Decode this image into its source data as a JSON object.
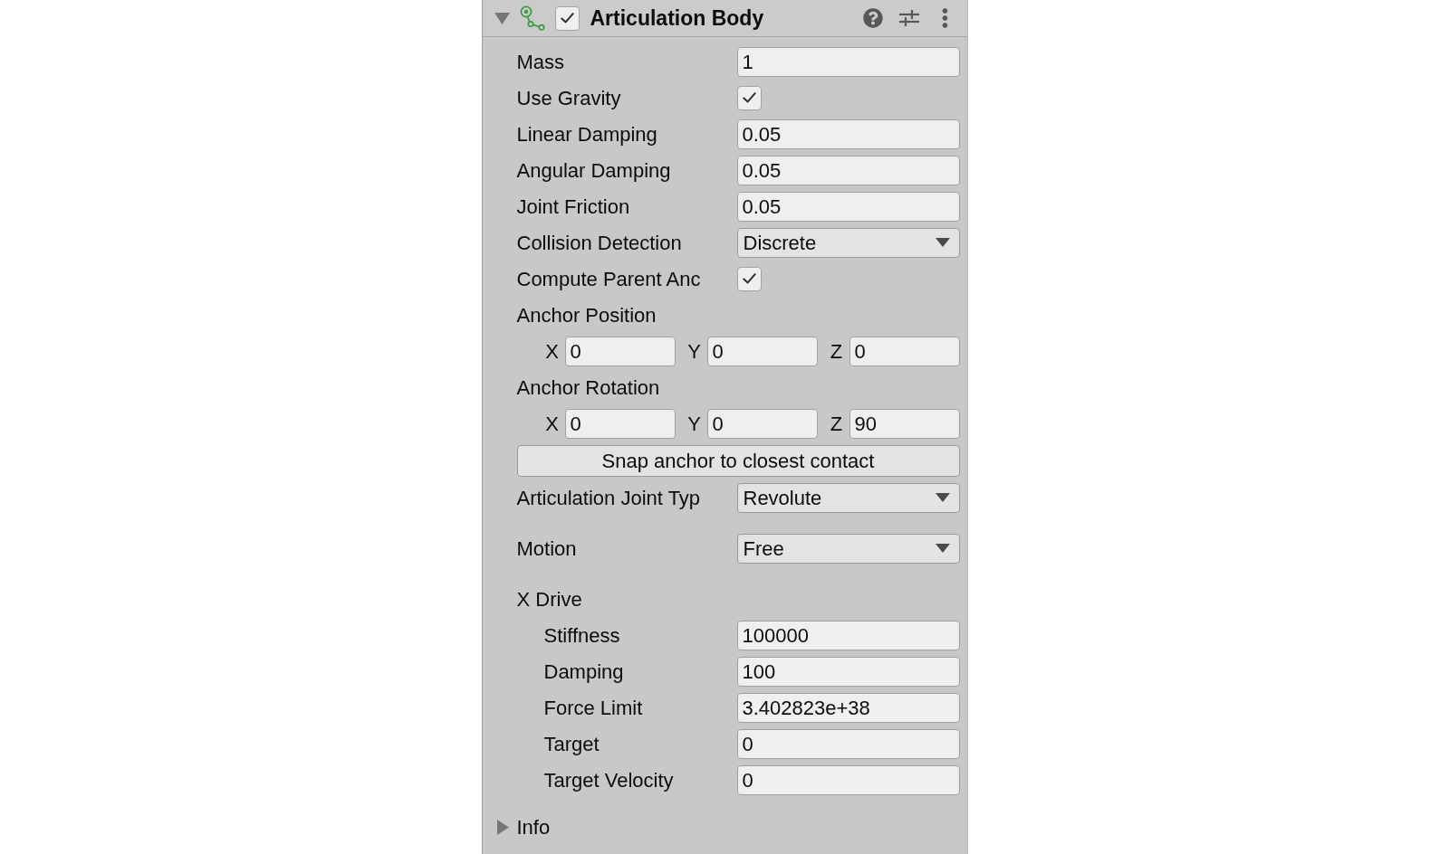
{
  "component": {
    "title": "Articulation Body",
    "expanded": true,
    "enabled": true
  },
  "groups": [
    {
      "properties": [
        {
          "kind": "number",
          "label": "Mass",
          "value": "1"
        },
        {
          "kind": "toggle",
          "label": "Use Gravity",
          "checked": true
        },
        {
          "kind": "number",
          "label": "Linear Damping",
          "value": "0.05"
        },
        {
          "kind": "number",
          "label": "Angular Damping",
          "value": "0.05"
        },
        {
          "kind": "number",
          "label": "Joint Friction",
          "value": "0.05"
        },
        {
          "kind": "dropdown",
          "label": "Collision Detection",
          "value": "Discrete"
        },
        {
          "kind": "toggle",
          "label": "Compute Parent Anc",
          "checked": true
        },
        {
          "kind": "vector",
          "label": "Anchor Position",
          "components": [
            {
              "axis": "X",
              "value": "0"
            },
            {
              "axis": "Y",
              "value": "0"
            },
            {
              "axis": "Z",
              "value": "0"
            }
          ]
        },
        {
          "kind": "vector",
          "label": "Anchor Rotation",
          "components": [
            {
              "axis": "X",
              "value": "0"
            },
            {
              "axis": "Y",
              "value": "0"
            },
            {
              "axis": "Z",
              "value": "90"
            }
          ]
        },
        {
          "kind": "button",
          "label": "Snap anchor to closest contact"
        },
        {
          "kind": "dropdown",
          "label": "Articulation Joint Typ",
          "value": "Revolute"
        }
      ]
    },
    {
      "properties": [
        {
          "kind": "dropdown",
          "label": "Motion",
          "value": "Free"
        }
      ]
    },
    {
      "properties": [
        {
          "kind": "section",
          "label": "X Drive",
          "children": [
            {
              "kind": "number",
              "label": "Stiffness",
              "value": "100000"
            },
            {
              "kind": "number",
              "label": "Damping",
              "value": "100"
            },
            {
              "kind": "number",
              "label": "Force Limit",
              "value": "3.402823e+38"
            },
            {
              "kind": "number",
              "label": "Target",
              "value": "0"
            },
            {
              "kind": "number",
              "label": "Target Velocity",
              "value": "0"
            }
          ]
        }
      ]
    }
  ],
  "info": {
    "label": "Info",
    "expanded": false
  }
}
